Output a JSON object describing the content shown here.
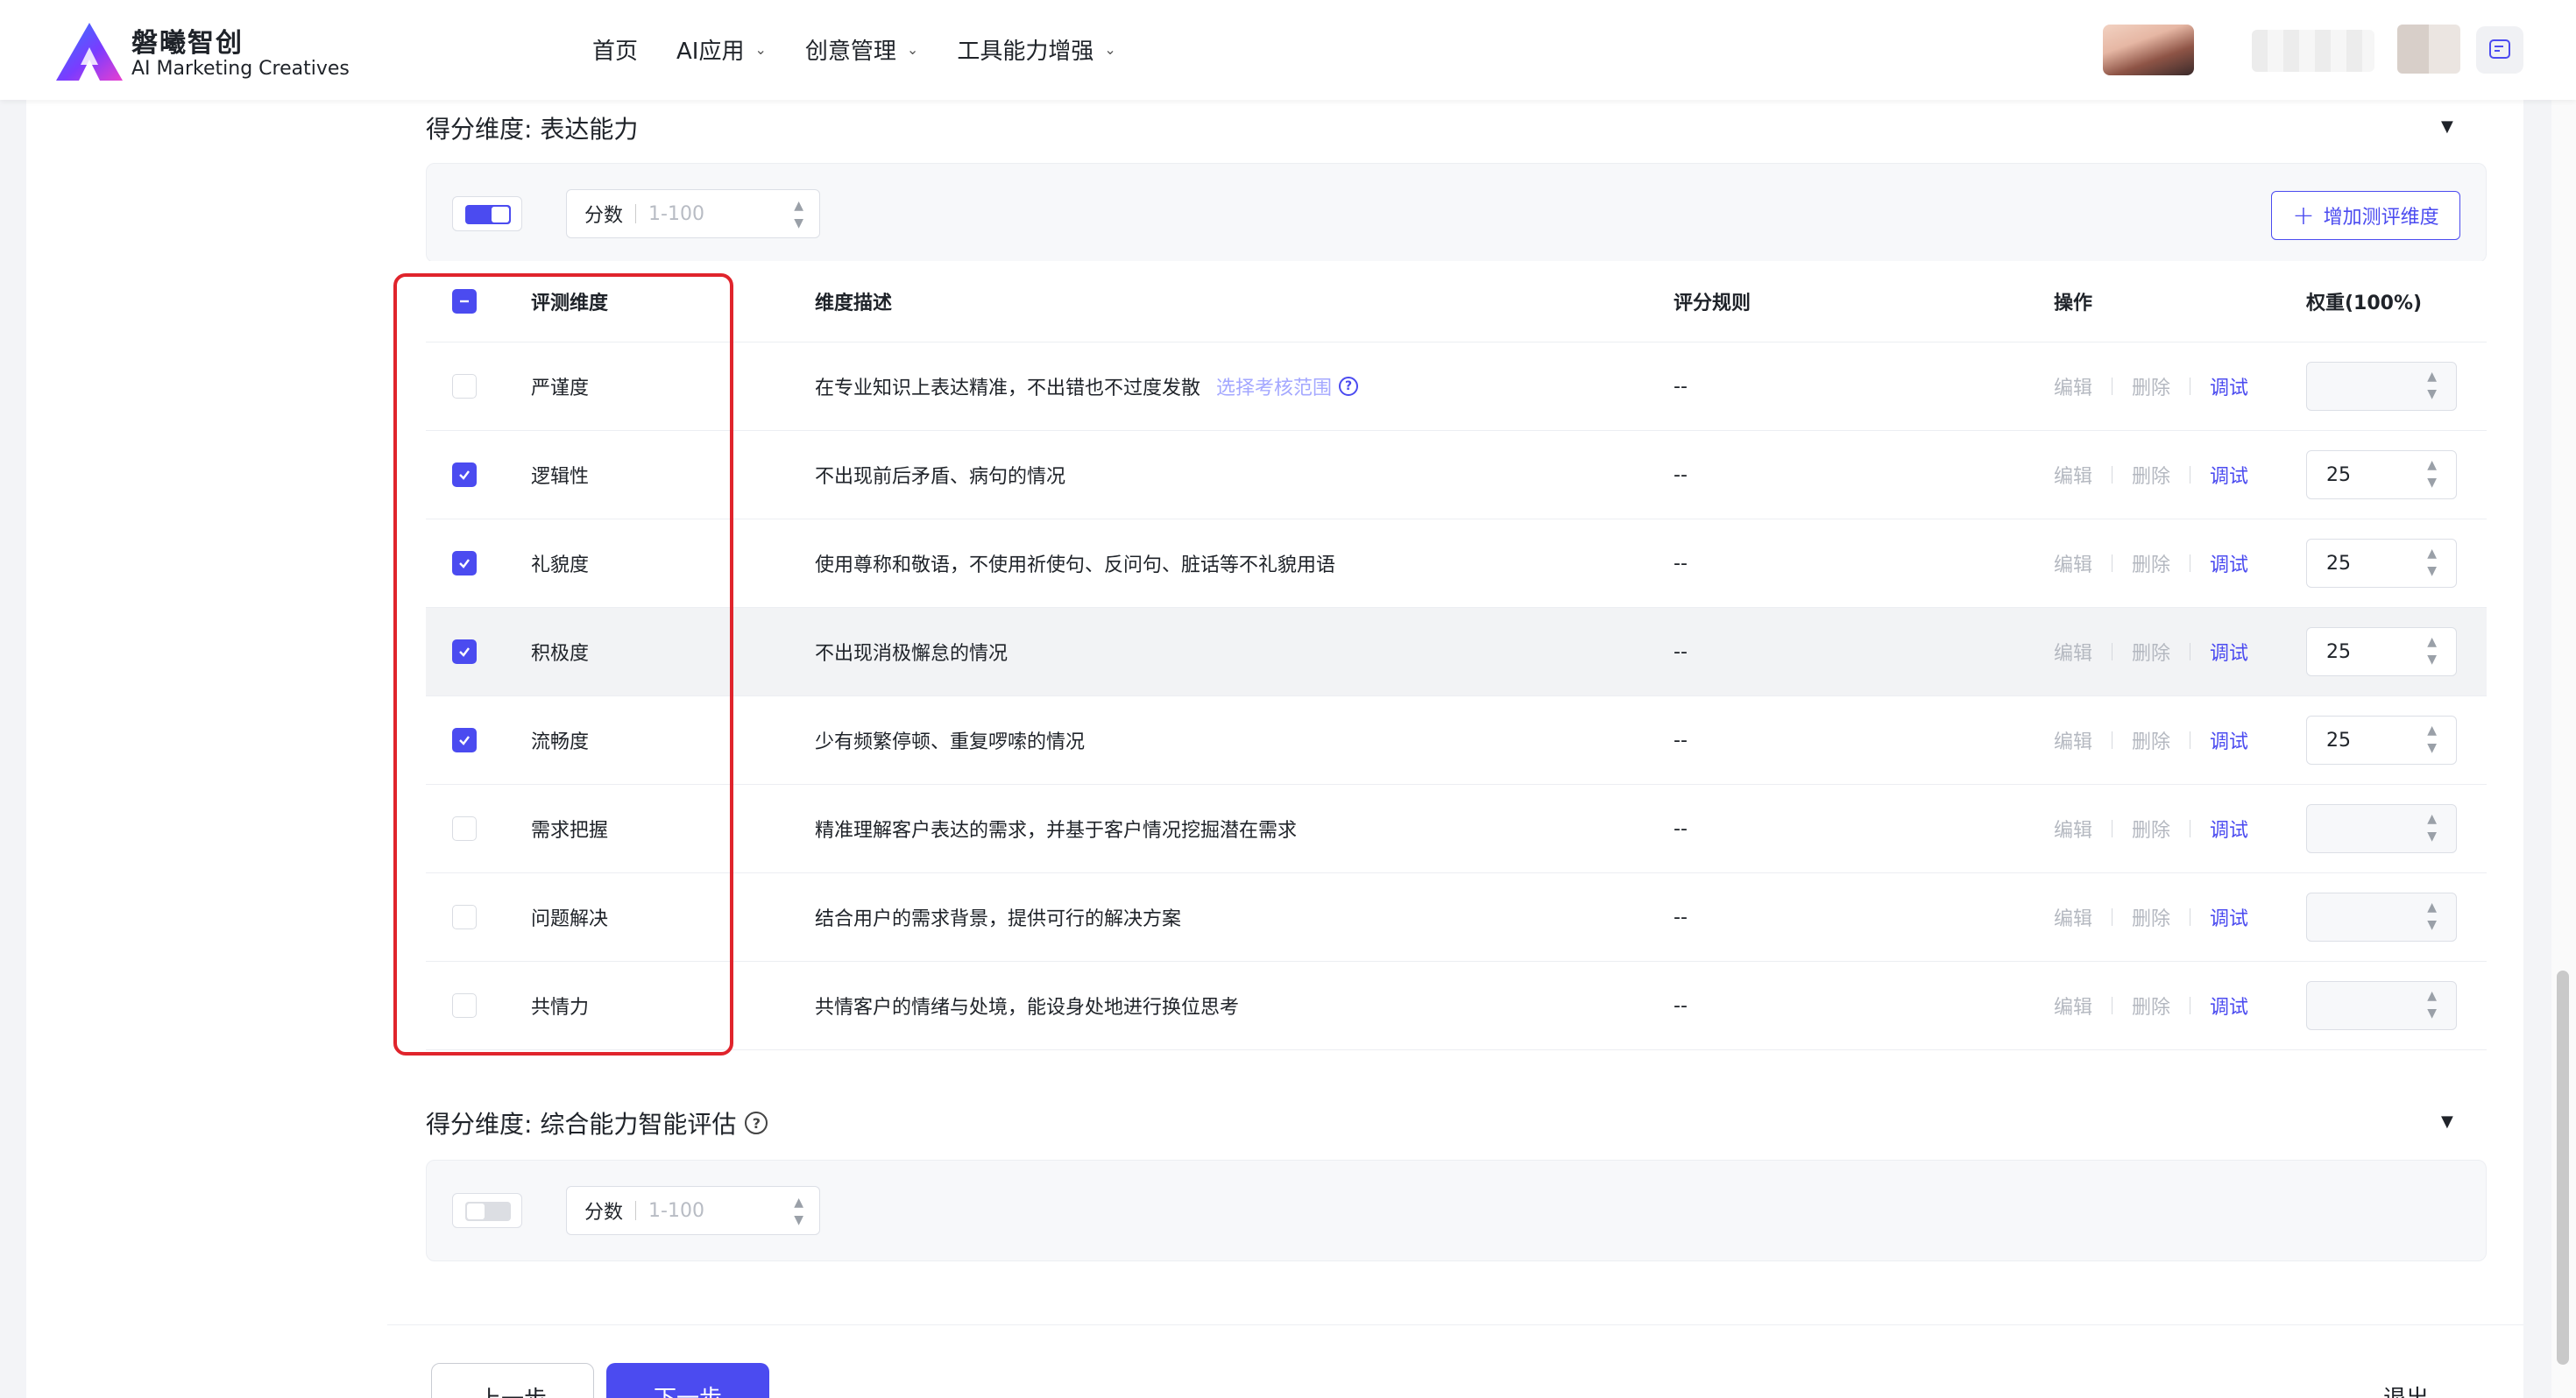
{
  "header": {
    "brand_cn": "磐曦智创",
    "brand_en": "AI Marketing Creatives",
    "nav": [
      {
        "label": "首页",
        "dropdown": false
      },
      {
        "label": "AI应用",
        "dropdown": true
      },
      {
        "label": "创意管理",
        "dropdown": true
      },
      {
        "label": "工具能力增强",
        "dropdown": true
      }
    ]
  },
  "section1": {
    "title": "得分维度: 表达能力",
    "toggle_on": true,
    "score_label": "分数",
    "score_placeholder": "1-100",
    "add_button": "增加测评维度",
    "columns": {
      "name": "评测维度",
      "desc": "维度描述",
      "rule": "评分规则",
      "ops": "操作",
      "weight": "权重(100%)"
    },
    "ops_labels": {
      "edit": "编辑",
      "delete": "删除",
      "debug": "调试"
    },
    "rows": [
      {
        "name": "严谨度",
        "desc": "在专业知识上表达精准，不出错也不过度发散",
        "hint": "选择考核范围",
        "rule": "--",
        "checked": false,
        "weight": ""
      },
      {
        "name": "逻辑性",
        "desc": "不出现前后矛盾、病句的情况",
        "hint": "",
        "rule": "--",
        "checked": true,
        "weight": "25"
      },
      {
        "name": "礼貌度",
        "desc": "使用尊称和敬语，不使用祈使句、反问句、脏话等不礼貌用语",
        "hint": "",
        "rule": "--",
        "checked": true,
        "weight": "25"
      },
      {
        "name": "积极度",
        "desc": "不出现消极懈怠的情况",
        "hint": "",
        "rule": "--",
        "checked": true,
        "weight": "25"
      },
      {
        "name": "流畅度",
        "desc": "少有频繁停顿、重复啰嗦的情况",
        "hint": "",
        "rule": "--",
        "checked": true,
        "weight": "25"
      },
      {
        "name": "需求把握",
        "desc": "精准理解客户表达的需求，并基于客户情况挖掘潜在需求",
        "hint": "",
        "rule": "--",
        "checked": false,
        "weight": ""
      },
      {
        "name": "问题解决",
        "desc": "结合用户的需求背景，提供可行的解决方案",
        "hint": "",
        "rule": "--",
        "checked": false,
        "weight": ""
      },
      {
        "name": "共情力",
        "desc": "共情客户的情绪与处境，能设身处地进行换位思考",
        "hint": "",
        "rule": "--",
        "checked": false,
        "weight": ""
      }
    ]
  },
  "section2": {
    "title": "得分维度: 综合能力智能评估",
    "toggle_on": false,
    "score_label": "分数",
    "score_placeholder": "1-100"
  },
  "footer": {
    "prev": "上一步",
    "next": "下一步",
    "exit": "退出"
  },
  "colors": {
    "accent": "#4b4bf0",
    "highlight_box": "#e0242c"
  }
}
